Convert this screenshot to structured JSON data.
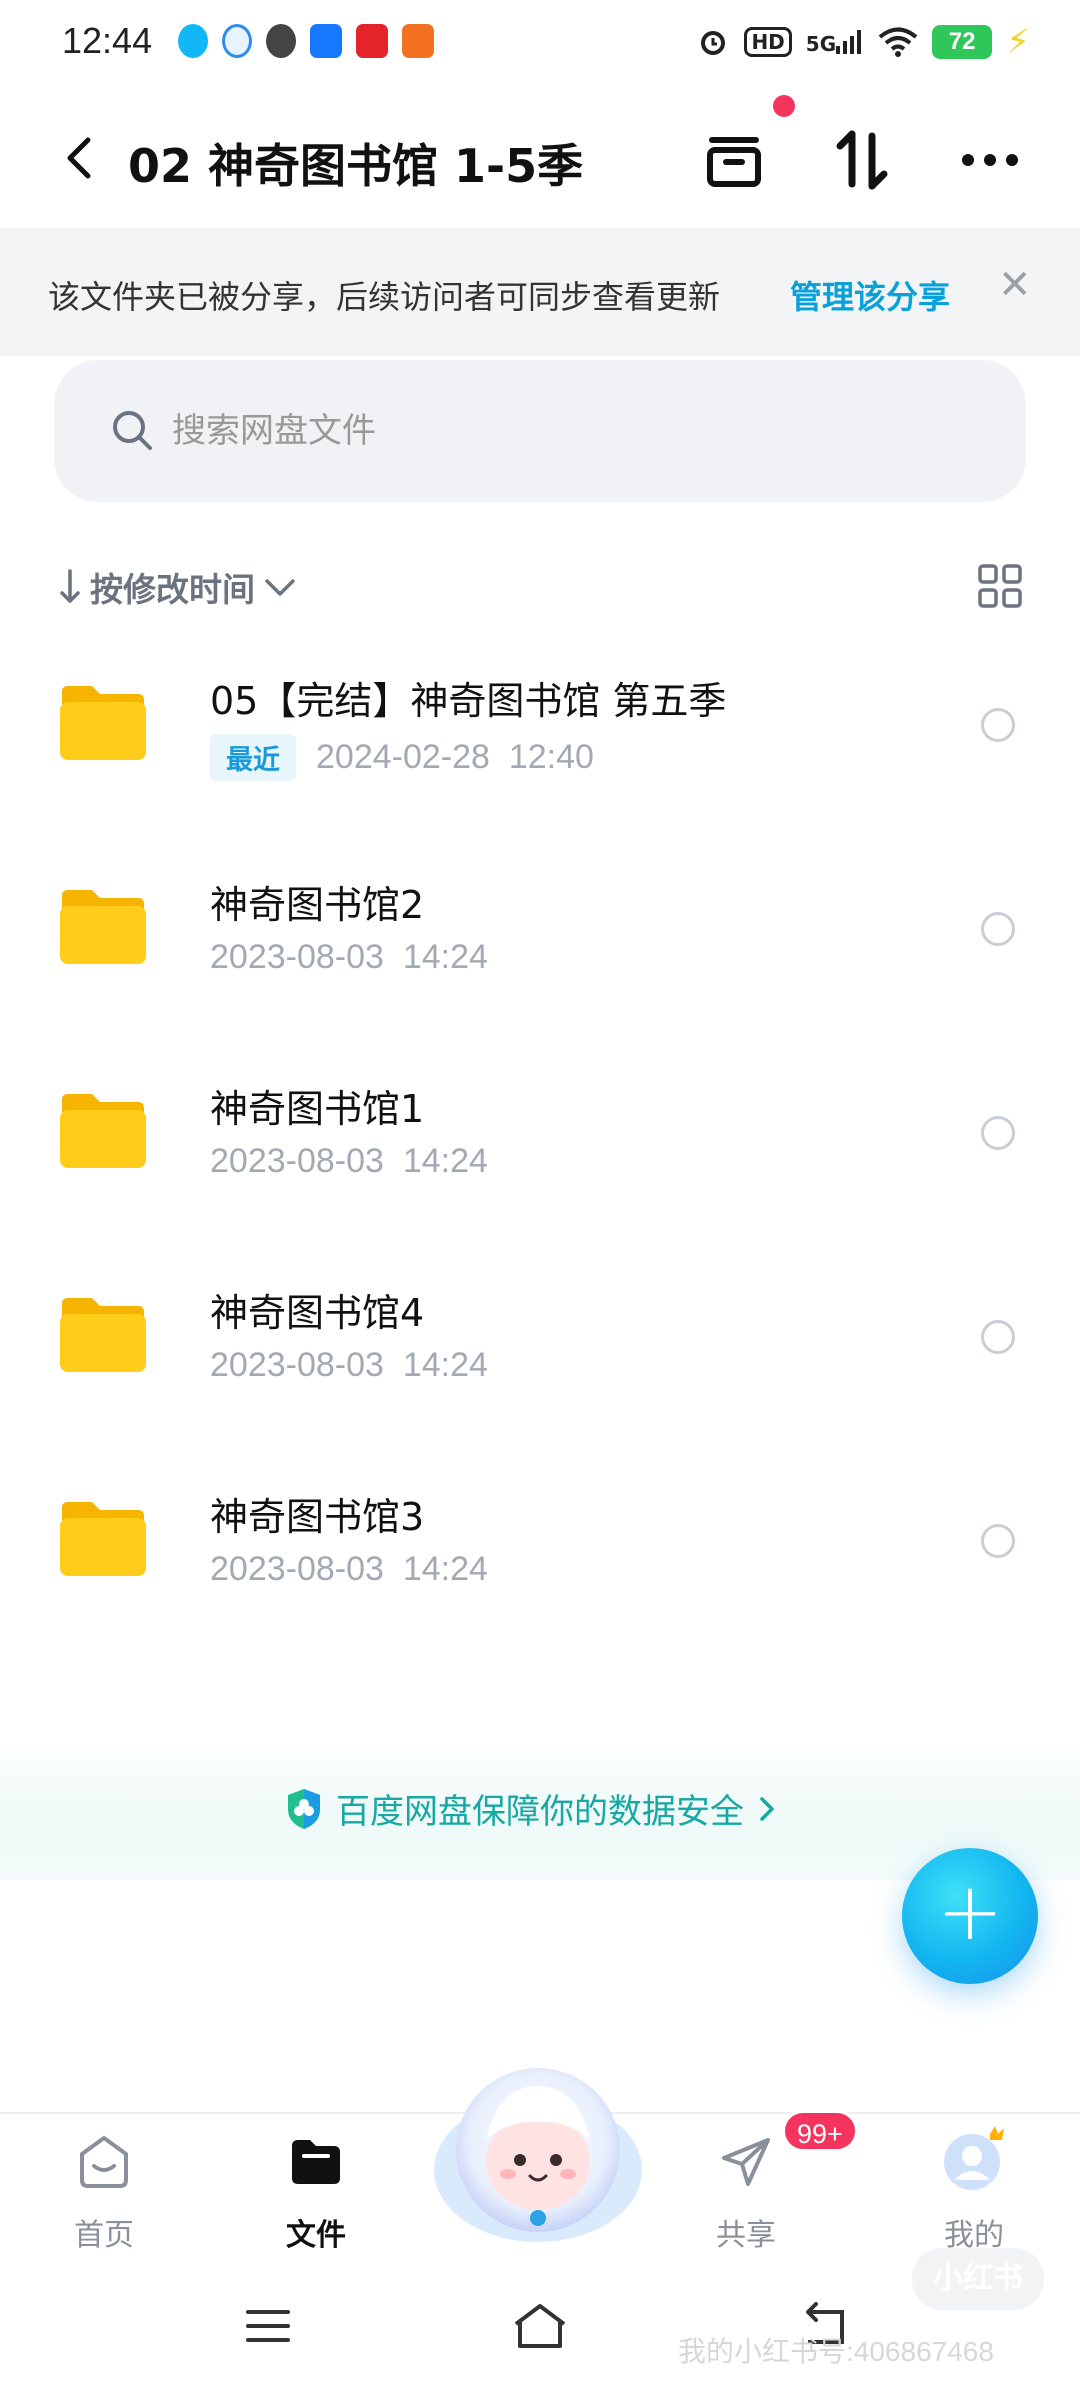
{
  "status_bar": {
    "time": "12:44",
    "battery": "72",
    "network": "5G",
    "hd_label": "HD"
  },
  "header": {
    "title": "02 神奇图书馆 1-5季"
  },
  "share_banner": {
    "text": "该文件夹已被分享，后续访问者可同步查看更新",
    "link": "管理该分享"
  },
  "search": {
    "placeholder": "搜索网盘文件"
  },
  "sort": {
    "label": "按修改时间"
  },
  "files": [
    {
      "name": "05【完结】神奇图书馆 第五季",
      "tag": "最近",
      "date": "2024-02-28",
      "time": "12:40"
    },
    {
      "name": "神奇图书馆2",
      "tag": "",
      "date": "2023-08-03",
      "time": "14:24"
    },
    {
      "name": "神奇图书馆1",
      "tag": "",
      "date": "2023-08-03",
      "time": "14:24"
    },
    {
      "name": "神奇图书馆4",
      "tag": "",
      "date": "2023-08-03",
      "time": "14:24"
    },
    {
      "name": "神奇图书馆3",
      "tag": "",
      "date": "2023-08-03",
      "time": "14:24"
    }
  ],
  "security": {
    "text": "百度网盘保障你的数据安全"
  },
  "tabs": {
    "home": "首页",
    "files": "文件",
    "share": "共享",
    "mine": "我的",
    "share_badge": "99+"
  },
  "watermark": {
    "text": "我的小红书号:406867468",
    "logo_text": "小红书"
  },
  "colors": {
    "accent": "#0aa1d9",
    "folder": "#ffc400",
    "badge": "#f4335f",
    "security": "#17a8a4"
  }
}
